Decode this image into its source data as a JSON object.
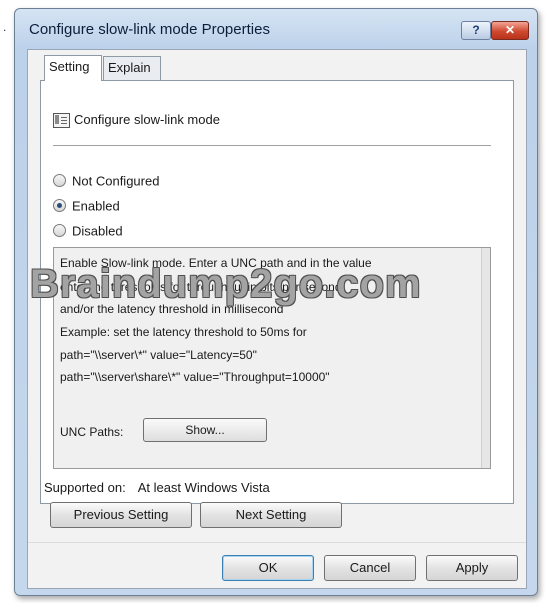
{
  "window": {
    "title": "Configure slow-link mode Properties",
    "help_glyph": "?",
    "close_glyph": "✕"
  },
  "tabs": [
    {
      "label": "Setting",
      "active": true
    },
    {
      "label": "Explain",
      "active": false
    }
  ],
  "policy": {
    "name": "Configure slow-link mode",
    "icon": "policy-setting-icon"
  },
  "options": [
    {
      "label": "Not Configured",
      "checked": false
    },
    {
      "label": "Enabled",
      "checked": true
    },
    {
      "label": "Disabled",
      "checked": false
    }
  ],
  "comment_lines": [
    "Enable Slow-link mode. Enter a UNC path and in the value",
    "enter the thresholds for throughput in bits per second",
    "and/or the latency threshold in millisecond",
    "Example: set the latency threshold to 50ms for",
    "path=\"\\\\server\\*\" value=\"Latency=50\"",
    "path=\"\\\\server\\share\\*\" value=\"Throughput=10000\""
  ],
  "unc": {
    "label": "UNC Paths:",
    "button": "Show..."
  },
  "supported": {
    "label": "Supported on:",
    "value": "At least Windows Vista"
  },
  "buttons": {
    "previous": "Previous Setting",
    "next": "Next Setting",
    "ok": "OK",
    "cancel": "Cancel",
    "apply": "Apply"
  },
  "watermark": "Braindump2go.com",
  "margin_mark": "."
}
